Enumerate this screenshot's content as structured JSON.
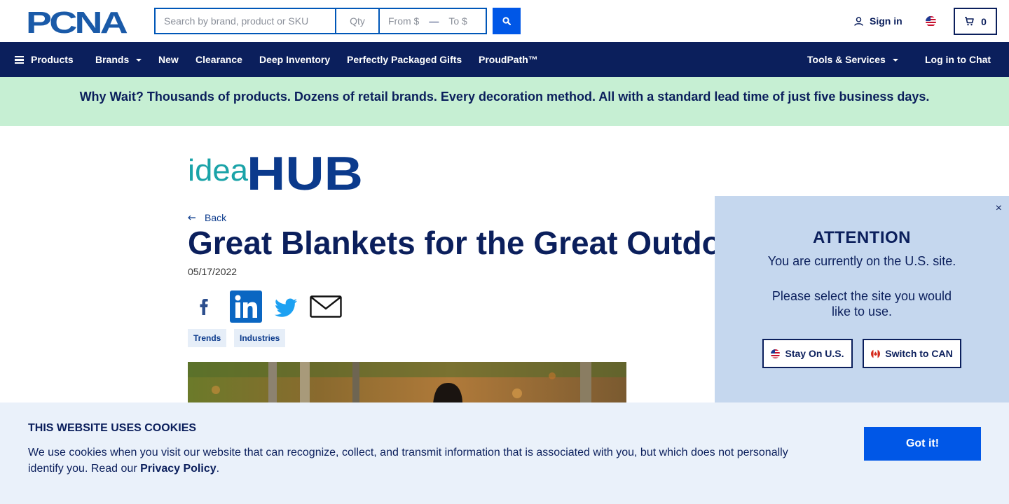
{
  "header": {
    "logo_text": "PCNA",
    "search": {
      "placeholder": "Search by brand, product or SKU"
    },
    "qty": {
      "placeholder": "Qty"
    },
    "price_range": {
      "from_label": "From $",
      "separator": "—",
      "to_label": "To $"
    },
    "search_button_icon": "search-icon",
    "sign_in_label": "Sign in",
    "cart_count": "0"
  },
  "nav": {
    "items": [
      {
        "label": "Products",
        "icon": "hamburger-icon"
      },
      {
        "label": "Brands",
        "has_dropdown": true
      },
      {
        "label": "New"
      },
      {
        "label": "Clearance"
      },
      {
        "label": "Deep Inventory"
      },
      {
        "label": "Perfectly Packaged Gifts"
      },
      {
        "label": "ProudPath™"
      },
      {
        "label": "Tools & Services",
        "has_dropdown": true
      },
      {
        "label": "Log in to Chat"
      }
    ]
  },
  "promo": {
    "text": "Why Wait? Thousands of products. Dozens of retail brands. Every decoration method. All with a standard lead time of just five business days."
  },
  "article": {
    "brand_logo": {
      "part1": "idea",
      "part2": "HUB"
    },
    "back_label": "Back",
    "title": "Great Blankets for the Great Outdoors",
    "date": "05/17/2022",
    "share_icons": [
      "facebook-icon",
      "linkedin-icon",
      "twitter-icon",
      "email-icon"
    ],
    "tags": [
      "Trends",
      "Industries"
    ]
  },
  "attention_modal": {
    "heading": "ATTENTION",
    "message1": "You are currently on the U.S. site.",
    "message2": "Please select the site you would like to use.",
    "stay_button": "Stay On U.S.",
    "switch_button": "Switch to CAN",
    "close_symbol": "×"
  },
  "cookie_banner": {
    "heading": "THIS WEBSITE USES COOKIES",
    "body": "We use cookies when you visit our website that can recognize, collect, and transmit information that is associated with you, but which does not personally identify you. Read our ",
    "link_text": "Privacy Policy",
    "body_end": ".",
    "button": "Got it!"
  },
  "colors": {
    "navy": "#0b1f5c",
    "primary_blue": "#0057e7",
    "promo_bg": "#c6efd3",
    "modal_bg": "#c5d7ee",
    "cookie_bg": "#eaf1fa",
    "logo_blue": "#1a5aa8",
    "idea_teal": "#1aa3a8"
  }
}
